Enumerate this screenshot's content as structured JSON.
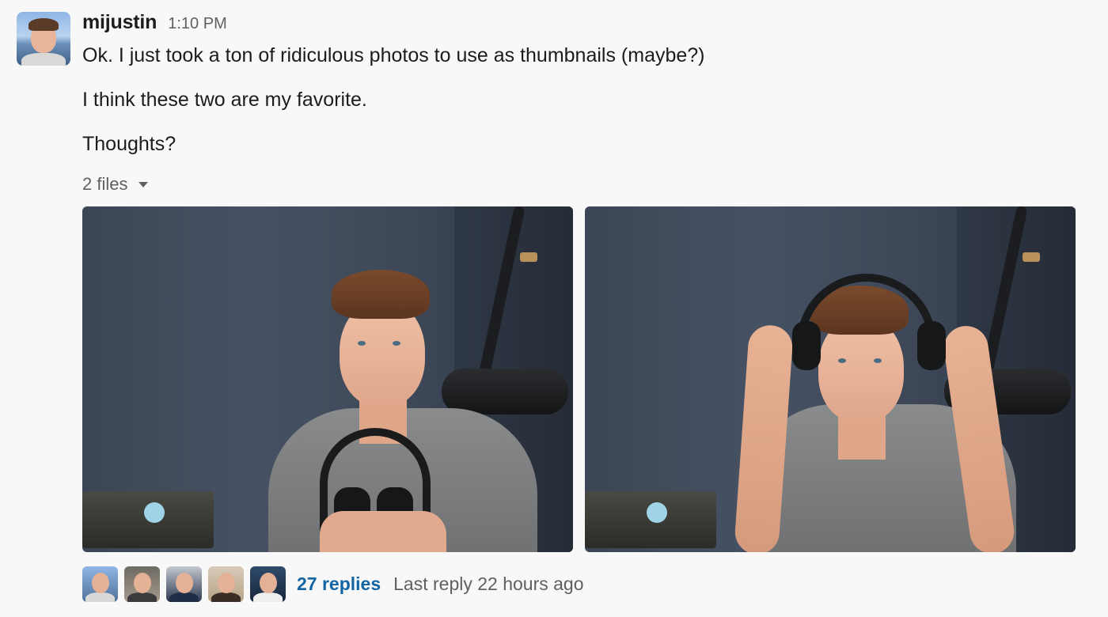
{
  "message": {
    "author": "mijustin",
    "time": "1:10 PM",
    "lines": [
      "Ok. I just took a ton of ridiculous photos to use as thumbnails (maybe?)",
      "I think these two are my favorite.",
      "Thoughts?"
    ],
    "files_label": "2 files",
    "files_toggle_icon": "caret-down-icon",
    "attachments": [
      {
        "description": "man holding headphones in front of microphone"
      },
      {
        "description": "man putting on headphones in front of microphone"
      }
    ]
  },
  "thread": {
    "participant_count": 5,
    "replies_label": "27 replies",
    "last_reply": "Last reply 22 hours ago",
    "link_color": "#1264a3"
  }
}
